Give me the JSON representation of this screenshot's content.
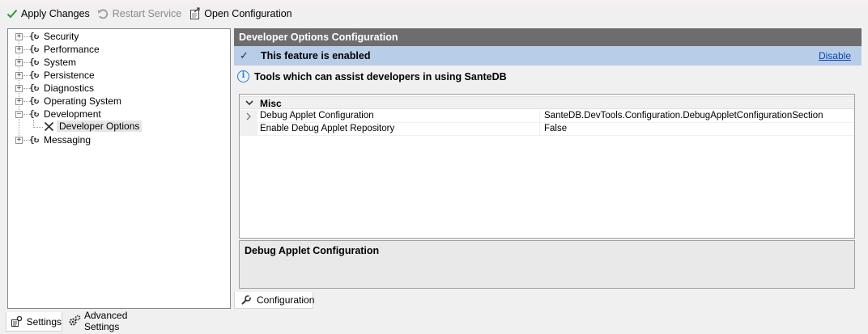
{
  "toolbar": {
    "apply_label": "Apply Changes",
    "restart_label": "Restart Service",
    "open_config_label": "Open Configuration"
  },
  "tree": {
    "items": [
      {
        "label": "Security",
        "expander": "+"
      },
      {
        "label": "Performance",
        "expander": "+"
      },
      {
        "label": "System",
        "expander": "+"
      },
      {
        "label": "Persistence",
        "expander": "+"
      },
      {
        "label": "Diagnostics",
        "expander": "+"
      },
      {
        "label": "Operating System",
        "expander": "+"
      },
      {
        "label": "Development",
        "expander": "−"
      },
      {
        "label": "Developer Options",
        "child": true,
        "selected": true
      },
      {
        "label": "Messaging",
        "expander": "+"
      }
    ]
  },
  "panel": {
    "title": "Developer Options Configuration",
    "status_text": "This feature is enabled",
    "disable_link": "Disable",
    "description": "Tools which can assist developers in using SanteDB"
  },
  "property_grid": {
    "category": "Misc",
    "rows": [
      {
        "name": "Debug Applet Configuration",
        "value": "SanteDB.DevTools.Configuration.DebugAppletConfigurationSection",
        "expandable": true
      },
      {
        "name": "Enable Debug Applet Repository",
        "value": "False",
        "expandable": false
      }
    ],
    "help_title": "Debug Applet Configuration"
  },
  "inner_tab": {
    "label": "Configuration"
  },
  "bottom_tabs": {
    "settings_label": "Settings",
    "advanced_label": "Advanced Settings"
  },
  "colors": {
    "panel_title_bg": "#6d6d6d",
    "enabled_bar_bg": "#b8cde8",
    "link": "#0645ad",
    "info_icon": "#1e7fd8",
    "apply_check": "#2e9a36"
  }
}
